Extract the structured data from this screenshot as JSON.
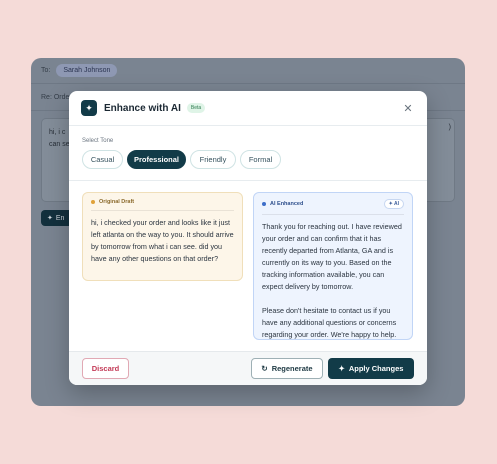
{
  "background_app": {
    "to_label": "To:",
    "recipient": "Sarah Johnson",
    "re_label": "Re: Order",
    "body_preview_line1": "hi, i c",
    "body_preview_line2": "can se",
    "body_right_fragment": ")",
    "enhance_button_label": "En"
  },
  "modal": {
    "title": "Enhance with AI",
    "beta_badge": "Beta",
    "close_icon": "close-icon",
    "tone_label": "Select Tone",
    "tones": [
      {
        "label": "Casual",
        "active": false
      },
      {
        "label": "Professional",
        "active": true
      },
      {
        "label": "Friendly",
        "active": false
      },
      {
        "label": "Formal",
        "active": false
      }
    ],
    "original": {
      "heading": "Original Draft",
      "text": "hi, i checked your order and looks like it just left atlanta on the way to you. It should arrive by tomorrow from what i can see. did you have any other questions on that order?"
    },
    "enhanced": {
      "heading": "AI Enhanced",
      "badge": "AI",
      "text": "Thank you for reaching out. I have reviewed your order and can confirm that it has recently departed from Atlanta, GA and is currently on its way to you. Based on the tracking information available, you can expect delivery by tomorrow.\n\nPlease don't hesitate to contact us if you have any additional questions or concerns regarding your order. We're happy to help."
    },
    "footer": {
      "discard_label": "Discard",
      "regenerate_label": "Regenerate",
      "apply_label": "Apply Changes"
    }
  },
  "colors": {
    "page_background": "#f5dbd8",
    "primary": "#123b48",
    "discard": "#c33b57",
    "enhanced_bg": "#eef4fe",
    "original_bg": "#fdf6e9"
  }
}
